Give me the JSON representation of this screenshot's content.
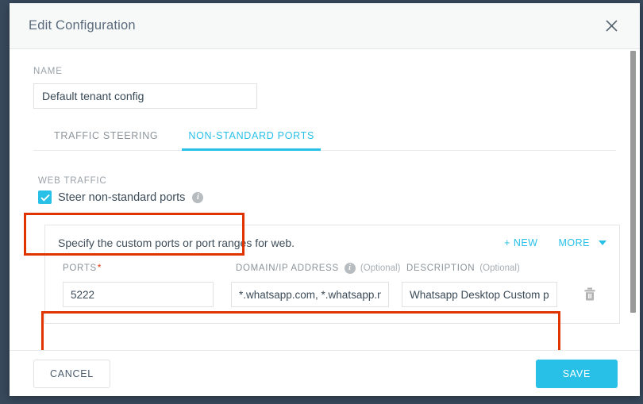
{
  "window": {
    "title": "Edit Configuration",
    "close_icon": "close-icon"
  },
  "name_field": {
    "label": "NAME",
    "value": "Default tenant config"
  },
  "tabs": [
    {
      "label": "TRAFFIC STEERING",
      "active": false
    },
    {
      "label": "NON-STANDARD PORTS",
      "active": true
    }
  ],
  "web_traffic": {
    "label": "WEB TRAFFIC",
    "checkbox_label": "Steer non-standard ports",
    "checked": true,
    "info_icon": "info-icon",
    "info_glyph": "i"
  },
  "ports_card": {
    "description": "Specify the custom ports or port ranges for web.",
    "new_button": "+ NEW",
    "more_button": "MORE",
    "caret_icon": "chevron-down-icon",
    "columns": [
      {
        "label": "PORTS",
        "required": "*",
        "optional": ""
      },
      {
        "label": "DOMAIN/IP ADDRESS",
        "required": "",
        "optional": "(Optional)"
      },
      {
        "label": "DESCRIPTION",
        "required": "",
        "optional": "(Optional)"
      }
    ],
    "rows": [
      {
        "ports": "5222",
        "domain": "*.whatsapp.com, *.whatsapp.net",
        "description": "Whatsapp Desktop Custom port",
        "delete_icon": "trash-icon"
      }
    ]
  },
  "footer": {
    "cancel_label": "CANCEL",
    "save_label": "SAVE"
  },
  "colors": {
    "accent": "#29c0e8",
    "highlight": "#e03400",
    "page_background": "#38495c",
    "header_background": "#f7f8f8",
    "text": "#3c4b58",
    "muted": "#9aa2a8"
  }
}
